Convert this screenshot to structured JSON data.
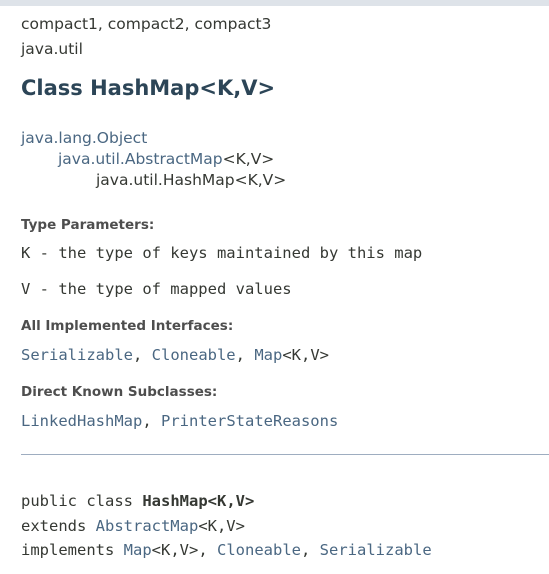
{
  "profiles": "compact1, compact2, compact3",
  "package": "java.util",
  "class_title": "Class HashMap<K,V>",
  "inheritance": {
    "root": "java.lang.Object",
    "parent_link": "java.util.AbstractMap",
    "parent_generic": "<K,V>",
    "current": "java.util.HashMap<K,V>"
  },
  "type_parameters": {
    "heading": "Type Parameters:",
    "items": [
      "K - the type of keys maintained by this map",
      "V - the type of mapped values"
    ]
  },
  "interfaces": {
    "heading": "All Implemented Interfaces:",
    "serializable": "Serializable",
    "sep1": ", ",
    "cloneable": "Cloneable",
    "sep2": ", ",
    "map": "Map",
    "map_generic": "<K,V>"
  },
  "subclasses": {
    "heading": "Direct Known Subclasses:",
    "linked": "LinkedHashMap",
    "sep": ", ",
    "printer": "PrinterStateReasons"
  },
  "declaration": {
    "l1_prefix": "public class ",
    "l1_name": "HashMap<K,V>",
    "l2_prefix": "extends ",
    "l2_link": "AbstractMap",
    "l2_generic": "<K,V>",
    "l3_prefix": "implements ",
    "l3_map": "Map",
    "l3_map_generic": "<K,V>",
    "l3_sep1": ", ",
    "l3_cloneable": "Cloneable",
    "l3_sep2": ", ",
    "l3_serializable": "Serializable"
  },
  "colors": {
    "link": "#4a6782",
    "title": "#2c4557",
    "text": "#353833",
    "header_band": "#dee3e9"
  }
}
